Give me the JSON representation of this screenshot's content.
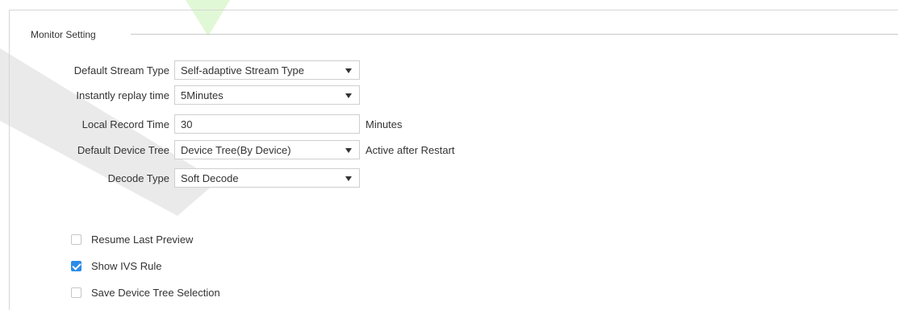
{
  "section": {
    "title": "Monitor Setting"
  },
  "fields": [
    {
      "label": "Default Stream Type",
      "value": "Self-adaptive Stream Type",
      "kind": "select",
      "suffix": ""
    },
    {
      "label": "Instantly replay time",
      "value": "5Minutes",
      "kind": "select",
      "suffix": ""
    },
    {
      "label": "Local Record Time",
      "value": "30",
      "kind": "input",
      "suffix": "Minutes"
    },
    {
      "label": "Default Device Tree",
      "value": "Device Tree(By Device)",
      "kind": "select",
      "suffix": "Active after Restart"
    },
    {
      "label": "Decode Type",
      "value": "Soft Decode",
      "kind": "select",
      "suffix": ""
    }
  ],
  "checkboxes": [
    {
      "label": "Resume Last Preview",
      "checked": false
    },
    {
      "label": "Show IVS Rule",
      "checked": true
    },
    {
      "label": "Save Device Tree Selection",
      "checked": false
    }
  ],
  "colors": {
    "accent": "#2b8ce8",
    "border": "#cfcfcf",
    "text": "#333333"
  },
  "icons": {
    "dropdown": "caret-down-icon",
    "check": "checkmark-icon"
  }
}
